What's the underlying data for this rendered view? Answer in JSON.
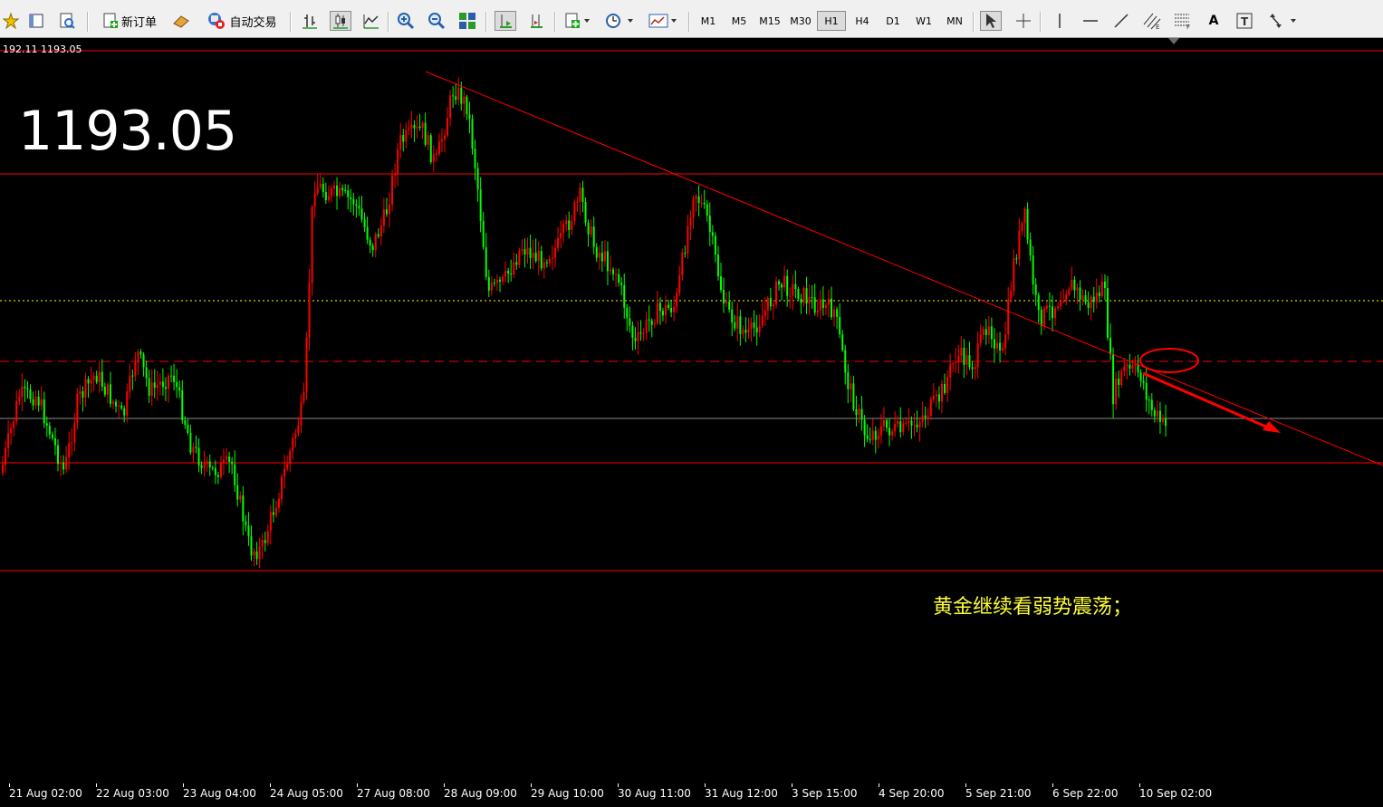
{
  "toolbar": {
    "new_order_label": "新订单",
    "auto_trading_label": "自动交易",
    "timeframes": [
      "M1",
      "M5",
      "M15",
      "M30",
      "H1",
      "H4",
      "D1",
      "W1",
      "MN"
    ],
    "selected_timeframe": "H1",
    "text_tool_label": "A"
  },
  "chart": {
    "ohlc_readout": "192.11 1193.05",
    "big_price": "1193.05",
    "annotation_text": "黄金继续看弱势震荡；",
    "annotation_color": "#ffff3a",
    "bull_candle_color": "#ff0000",
    "bear_candle_color": "#00ff00"
  },
  "x_axis": {
    "labels": [
      "21 Aug 02:00",
      "22 Aug 03:00",
      "23 Aug 04:00",
      "24 Aug 05:00",
      "27 Aug 08:00",
      "28 Aug 09:00",
      "29 Aug 10:00",
      "30 Aug 11:00",
      "31 Aug 12:00",
      "3 Sep 15:00",
      "4 Sep 20:00",
      "5 Sep 21:00",
      "6 Sep 22:00",
      "10 Sep 02:00"
    ]
  }
}
